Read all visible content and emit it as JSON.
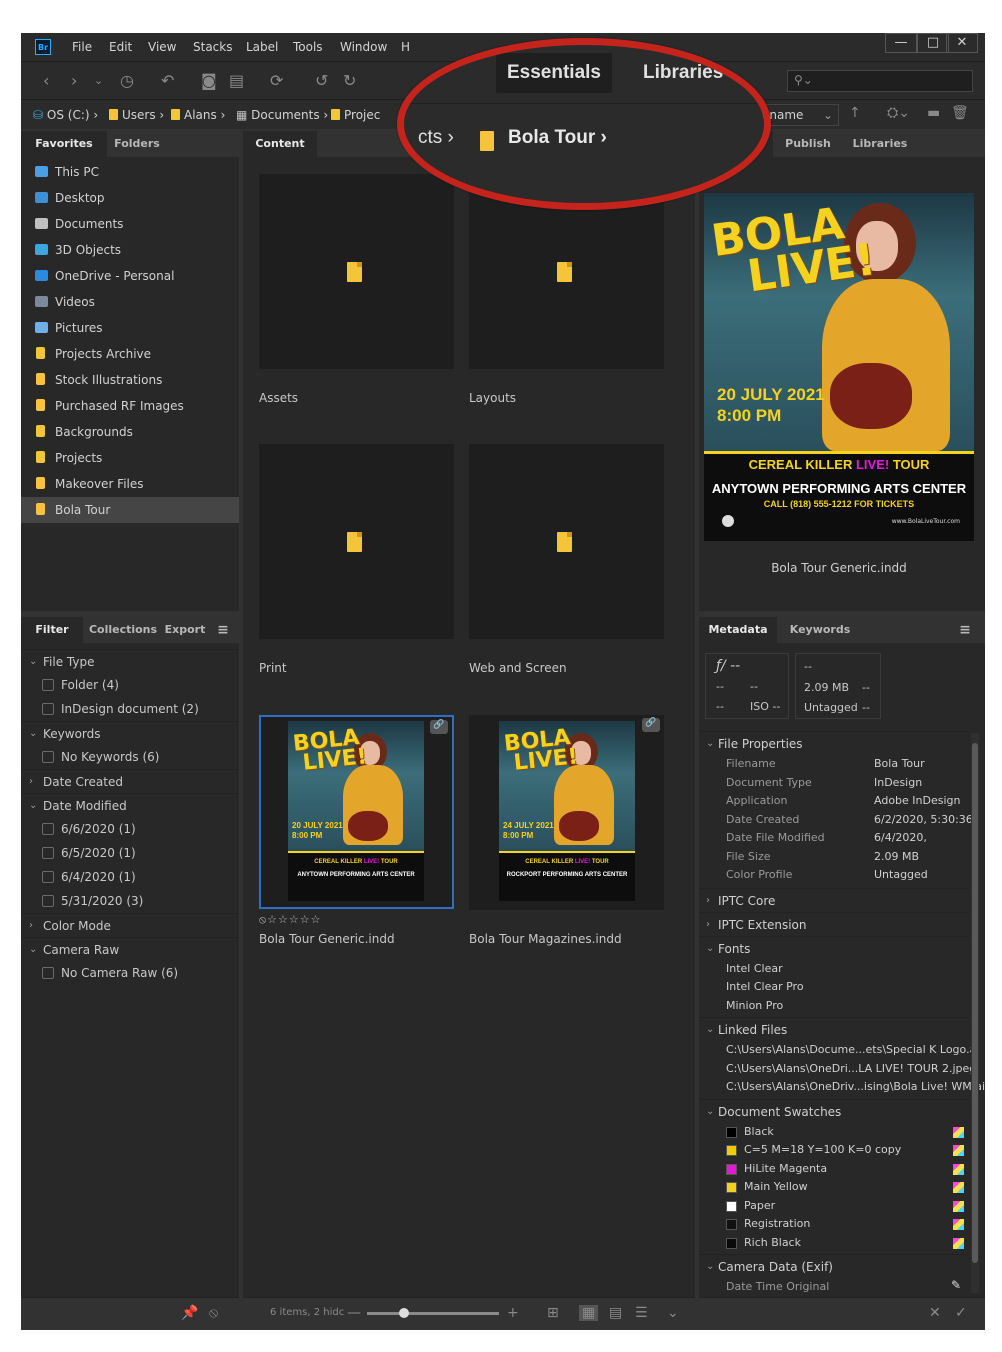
{
  "menubar": {
    "logo": "Br",
    "items": [
      "File",
      "Edit",
      "View",
      "Stacks",
      "Label",
      "Tools",
      "Window",
      "H"
    ],
    "window_controls": [
      "—",
      "□",
      "✕"
    ]
  },
  "workspace": {
    "essentials": "Essentials",
    "libraries": "Libraries"
  },
  "search": {
    "placeholder": ""
  },
  "breadcrumb": {
    "os": "OS (C:)",
    "users": "Users",
    "alans": "Alans",
    "documents": "Documents",
    "projects_short": "Projec",
    "projects_big": "cts",
    "current": "Bola Tour",
    "sort": "ename"
  },
  "left_panel": {
    "tabs": [
      "Favorites",
      "Folders"
    ],
    "favorites": [
      {
        "label": "This PC",
        "icon": "computer-icon",
        "color": "#4aa0e6"
      },
      {
        "label": "Desktop",
        "icon": "desktop-icon",
        "color": "#3d8fd8"
      },
      {
        "label": "Documents",
        "icon": "documents-icon",
        "color": "#c0c0c0"
      },
      {
        "label": "3D Objects",
        "icon": "cube-icon",
        "color": "#3aa7e0"
      },
      {
        "label": "OneDrive - Personal",
        "icon": "cloud-icon",
        "color": "#2a8ae0"
      },
      {
        "label": "Videos",
        "icon": "video-icon",
        "color": "#7a8a9a"
      },
      {
        "label": "Pictures",
        "icon": "pictures-icon",
        "color": "#6fb0e8"
      },
      {
        "label": "Projects Archive",
        "icon": "folder-icon",
        "color": "#f6c43b"
      },
      {
        "label": "Stock Illustrations",
        "icon": "folder-icon",
        "color": "#f6c43b"
      },
      {
        "label": "Purchased RF Images",
        "icon": "folder-icon",
        "color": "#f6c43b"
      },
      {
        "label": "Backgrounds",
        "icon": "folder-icon",
        "color": "#f6c43b"
      },
      {
        "label": "Projects",
        "icon": "folder-icon",
        "color": "#f6c43b"
      },
      {
        "label": "Makeover Files",
        "icon": "folder-icon",
        "color": "#f6c43b"
      },
      {
        "label": "Bola Tour",
        "icon": "folder-icon",
        "color": "#f6c43b"
      }
    ]
  },
  "filter_panel": {
    "tabs": [
      "Filter",
      "Collections",
      "Export"
    ],
    "rows": [
      {
        "type": "hdr",
        "label": "File Type",
        "open": true
      },
      {
        "type": "item",
        "label": "Folder (4)"
      },
      {
        "type": "item",
        "label": "InDesign document (2)"
      },
      {
        "type": "hdr",
        "label": "Keywords",
        "open": true
      },
      {
        "type": "item",
        "label": "No Keywords (6)"
      },
      {
        "type": "hdr",
        "label": "Date Created",
        "open": false
      },
      {
        "type": "hdr",
        "label": "Date Modified",
        "open": true
      },
      {
        "type": "item",
        "label": "6/6/2020 (1)"
      },
      {
        "type": "item",
        "label": "6/5/2020 (1)"
      },
      {
        "type": "item",
        "label": "6/4/2020 (1)"
      },
      {
        "type": "item",
        "label": "5/31/2020 (3)"
      },
      {
        "type": "hdr",
        "label": "Color Mode",
        "open": false
      },
      {
        "type": "hdr",
        "label": "Camera Raw",
        "open": true
      },
      {
        "type": "item",
        "label": "No Camera Raw (6)"
      }
    ]
  },
  "content": {
    "tab": "Content",
    "folders": [
      "Assets",
      "Layouts",
      "Print",
      "Web and Screen"
    ],
    "files": [
      {
        "name": "Bola Tour Generic.indd",
        "rating": "⦸☆☆☆☆☆",
        "date": "20 JULY 2021",
        "time": "8:00 PM",
        "venue": "ANYTOWN PERFORMING ARTS CENTER"
      },
      {
        "name": "Bola Tour Magazines.indd",
        "rating": "",
        "date": "24 JULY 2021",
        "time": "8:00 PM",
        "venue": "ROCKPORT PERFORMING ARTS CENTER"
      }
    ],
    "status": "6 items, 2 hidc"
  },
  "poster": {
    "title1": "BOLA",
    "title2": "LIVE!",
    "date": "20 JULY 2021",
    "time": "8:00 PM",
    "tour_a": "CEREAL KILLER ",
    "tour_b": "LIVE!",
    "tour_c": " TOUR",
    "venue": "ANYTOWN PERFORMING ARTS CENTER",
    "call": "CALL (818) 555-1212 FOR TICKETS",
    "url": "www.BolaLiveTour.com"
  },
  "preview_panel": {
    "tabs": [
      "eview",
      "Publish",
      "Libraries"
    ],
    "filename": "Bola Tour Generic.indd"
  },
  "metadata_panel": {
    "tabs": [
      "Metadata",
      "Keywords"
    ],
    "camera": {
      "fstop": "ƒ/ --",
      "shutter": "--",
      "a": "--",
      "b": "--",
      "c": "--",
      "iso": "ISO --"
    },
    "summary": {
      "dash": "--",
      "size": "2.09 MB",
      "size_dash": "--",
      "profile": "Untagged",
      "profile_dash": "--"
    },
    "sections": {
      "file_properties": "File Properties",
      "iptc_core": "IPTC Core",
      "iptc_ext": "IPTC Extension",
      "fonts": "Fonts",
      "linked": "Linked Files",
      "swatches": "Document Swatches",
      "camera": "Camera Data (Exif)"
    },
    "file_properties": [
      {
        "k": "Filename",
        "v": "Bola Tour"
      },
      {
        "k": "Document Type",
        "v": "InDesign"
      },
      {
        "k": "Application",
        "v": "Adobe InDesign"
      },
      {
        "k": "Date Created",
        "v": "6/2/2020, 5:30:36"
      },
      {
        "k": "Date File Modified",
        "v": "6/4/2020,"
      },
      {
        "k": "File Size",
        "v": "2.09 MB"
      },
      {
        "k": "Color Profile",
        "v": "Untagged"
      }
    ],
    "fonts": [
      "Intel Clear",
      "Intel Clear Pro",
      "Minion Pro"
    ],
    "linked_files": [
      "C:\\Users\\Alans\\Docume...ets\\Special K Logo.ai",
      "C:\\Users\\Alans\\OneDri...LA LIVE! TOUR 2.jpeg",
      "C:\\Users\\Alans\\OneDriv...ising\\Bola Live! WM.ai"
    ],
    "swatches": [
      {
        "name": "Black",
        "color": "#000000"
      },
      {
        "name": "C=5 M=18 Y=100 K=0 copy",
        "color": "#f3cc00"
      },
      {
        "name": "HiLite Magenta",
        "color": "#e619d6"
      },
      {
        "name": "Main Yellow",
        "color": "#f5d11e"
      },
      {
        "name": "Paper",
        "color": "#ffffff"
      },
      {
        "name": "Registration",
        "color": "#111111"
      },
      {
        "name": "Rich Black",
        "color": "#0a0a0a"
      }
    ],
    "exif": {
      "k": "Date Time Original"
    }
  }
}
